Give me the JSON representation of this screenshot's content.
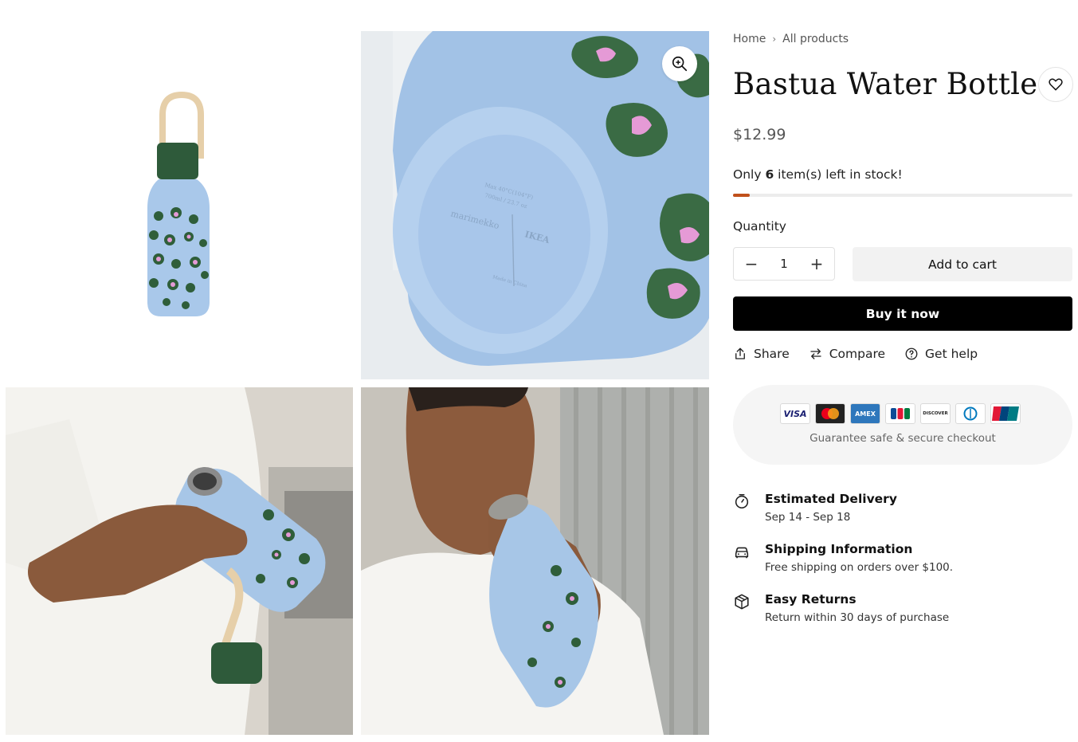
{
  "gallery": {
    "images": [
      {
        "alt": "Bastua water bottle with handle, product shot"
      },
      {
        "alt": "Bottom of bottle with marimekko and IKEA markings"
      },
      {
        "alt": "Hands holding open bottle"
      },
      {
        "alt": "Man drinking from bottle"
      }
    ]
  },
  "breadcrumb": {
    "home": "Home",
    "current": "All products"
  },
  "product": {
    "title": "Bastua Water Bottle",
    "price": "$12.99",
    "stock_prefix": "Only ",
    "stock_count": "6",
    "stock_suffix": " item(s) left in stock!",
    "stock_level_fraction": 0.05
  },
  "quantity": {
    "label": "Quantity",
    "value": "1"
  },
  "buttons": {
    "add_to_cart": "Add to cart",
    "buy_now": "Buy it now"
  },
  "actions": [
    {
      "label": "Share",
      "icon": "share-icon"
    },
    {
      "label": "Compare",
      "icon": "compare-icon"
    },
    {
      "label": "Get help",
      "icon": "help-icon"
    }
  ],
  "payment": {
    "cards": [
      "VISA",
      "Mastercard",
      "AMEX",
      "JCB",
      "DISCOVER",
      "Diners",
      "UnionPay"
    ],
    "guarantee": "Guarantee safe & secure checkout"
  },
  "features": [
    {
      "title": "Estimated Delivery",
      "subtitle": "Sep 14 - Sep 18",
      "icon": "stopwatch-icon"
    },
    {
      "title": "Shipping Information",
      "subtitle": "Free shipping on orders over $100.",
      "icon": "car-icon"
    },
    {
      "title": "Easy Returns",
      "subtitle": "Return within 30 days of purchase",
      "icon": "box-icon"
    }
  ],
  "colors": {
    "accent": "#000000",
    "stock_bar": "#c0501b",
    "bottle_blue": "#a9c8ea",
    "leaf_green": "#2f5e3a",
    "flower_pink": "#e59ad6"
  }
}
